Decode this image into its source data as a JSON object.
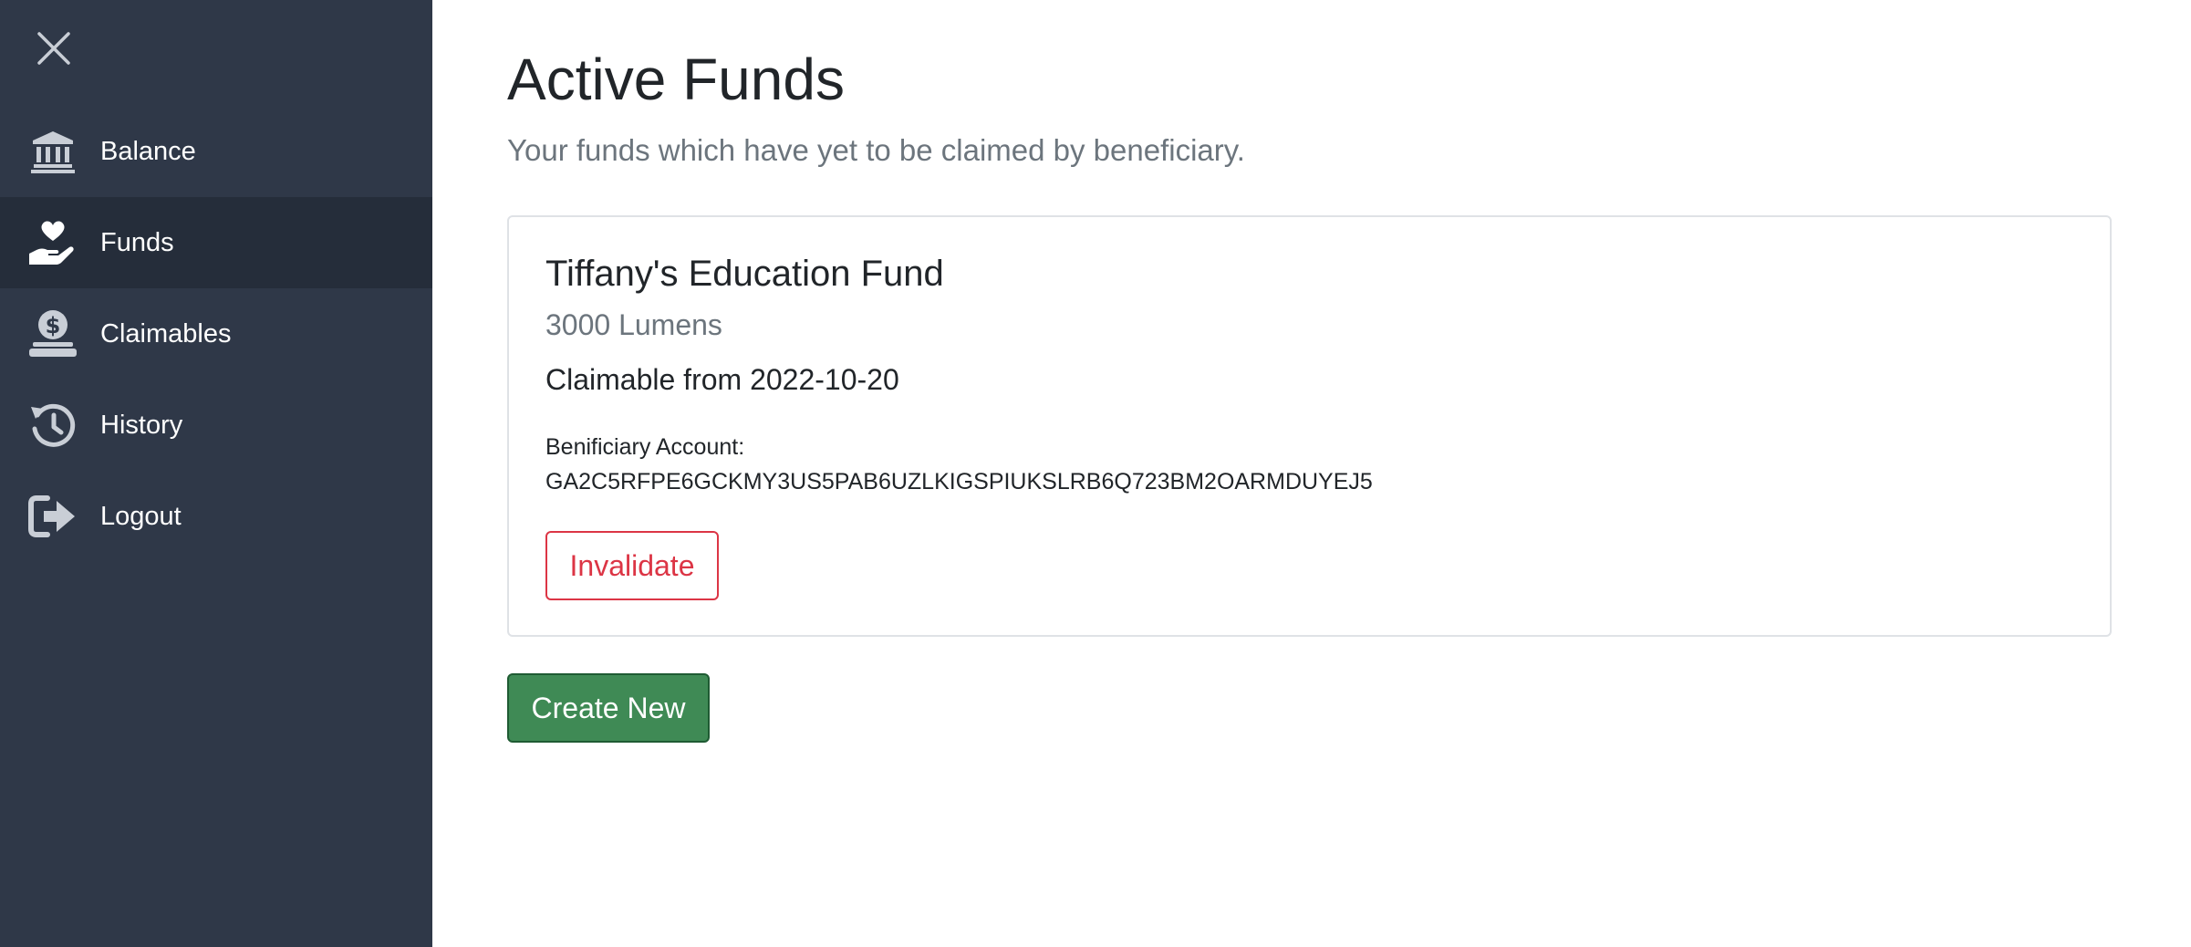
{
  "sidebar": {
    "close_icon": "close-icon",
    "items": [
      {
        "label": "Balance",
        "icon": "bank-icon",
        "active": false
      },
      {
        "label": "Funds",
        "icon": "hand-holding-heart-icon",
        "active": true
      },
      {
        "label": "Claimables",
        "icon": "hand-holding-dollar-icon",
        "active": false
      },
      {
        "label": "History",
        "icon": "history-icon",
        "active": false
      },
      {
        "label": "Logout",
        "icon": "logout-icon",
        "active": false
      }
    ],
    "colors": {
      "background": "#2f3848",
      "active_background": "#252d3a",
      "text": "#ffffff"
    }
  },
  "main": {
    "title": "Active Funds",
    "subtitle": "Your funds which have yet to be claimed by beneficiary.",
    "funds": [
      {
        "name": "Tiffany's Education Fund",
        "amount": "3000 Lumens",
        "claimable": "Claimable from 2022-10-20",
        "beneficiary_label": "Benificiary Account:",
        "beneficiary_account": "GA2C5RFPE6GCKMY3US5PAB6UZLKIGSPIUKSLRB6Q723BM2OARMDUYEJ5",
        "invalidate_label": "Invalidate"
      }
    ],
    "create_label": "Create New"
  },
  "colors": {
    "danger": "#dc3545",
    "success": "#3f8a55",
    "muted": "#6c757d",
    "text": "#212529"
  }
}
